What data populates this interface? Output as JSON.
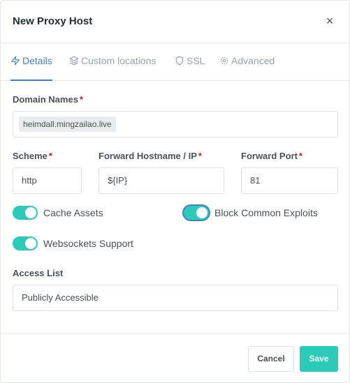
{
  "modal": {
    "title": "New Proxy Host",
    "close_glyph": "×"
  },
  "tabs": [
    {
      "label": "Details",
      "icon": "zap-icon",
      "active": true
    },
    {
      "label": "Custom locations",
      "icon": "layers-icon",
      "active": false
    },
    {
      "label": "SSL",
      "icon": "shield-icon",
      "active": false
    },
    {
      "label": "Advanced",
      "icon": "gear-icon",
      "active": false
    }
  ],
  "form": {
    "domain_names": {
      "label": "Domain Names",
      "required_mark": "*",
      "values": [
        "heimdall.mingzailao.live"
      ]
    },
    "scheme": {
      "label": "Scheme",
      "required_mark": "*",
      "value": "http"
    },
    "forward_host": {
      "label": "Forward Hostname / IP",
      "required_mark": "*",
      "value": "${IP}"
    },
    "forward_port": {
      "label": "Forward Port",
      "required_mark": "*",
      "value": "81"
    },
    "toggles": {
      "cache_assets": {
        "label": "Cache Assets",
        "on": true
      },
      "block_exploits": {
        "label": "Block Common Exploits",
        "on": true
      },
      "websockets": {
        "label": "Websockets Support",
        "on": true
      }
    },
    "access_list": {
      "label": "Access List",
      "value": "Publicly Accessible"
    }
  },
  "footer": {
    "cancel_label": "Cancel",
    "save_label": "Save"
  },
  "colors": {
    "accent": "#467fcf",
    "toggle_on": "#2bcbba",
    "required": "#cd201f"
  }
}
